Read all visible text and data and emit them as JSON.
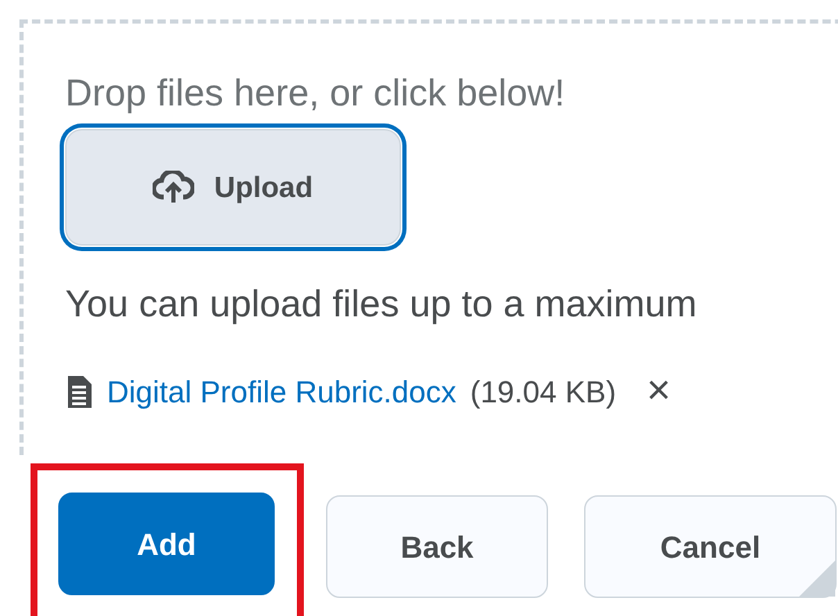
{
  "dropzone": {
    "prompt": "Drop files here, or click below!",
    "upload_button": {
      "label": "Upload",
      "focused": true
    },
    "limit_note": "You can upload files up to a maximum",
    "files": [
      {
        "name": "Digital Profile Rubric.docx",
        "size": "(19.04 KB)",
        "remove": "×"
      }
    ]
  },
  "buttons": [
    {
      "label": "Add",
      "primary": true,
      "highlighted": true
    },
    {
      "label": "Back",
      "primary": false,
      "highlighted": false
    },
    {
      "label": "Cancel",
      "primary": false,
      "highlighted": false
    }
  ]
}
